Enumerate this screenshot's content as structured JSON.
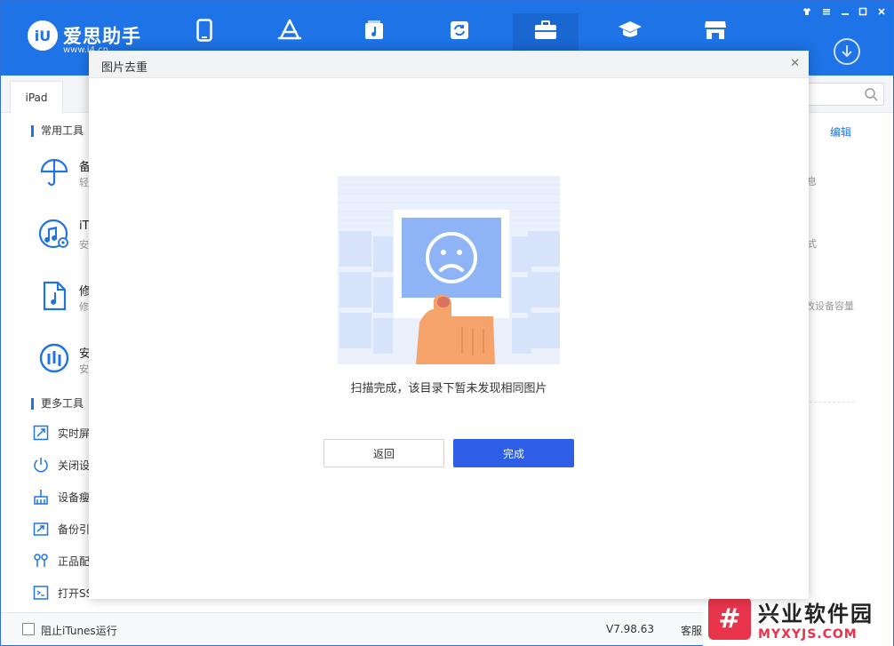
{
  "app": {
    "logo_badge": "iU",
    "logo_name": "爱思助手",
    "logo_url": "www.i4.cn",
    "nav_icons": [
      "phone-icon",
      "app-store-icon",
      "music-icon",
      "sync-icon",
      "toolbox-icon",
      "graduation-cap-icon",
      "store-icon"
    ],
    "window_controls": [
      "shirt-icon",
      "menu-icon",
      "minimize-icon",
      "maximize-icon",
      "close-icon"
    ]
  },
  "device_tab": "iPad",
  "sidebar": {
    "common_tools_title": "常用工具",
    "common_tools": [
      {
        "icon": "umbrella-icon",
        "t1": "备",
        "t2": "轻"
      },
      {
        "icon": "itunes-icon",
        "t1": "iT",
        "t2": "安"
      },
      {
        "icon": "music-file-icon",
        "t1": "修",
        "t2": "修"
      },
      {
        "icon": "i4-shield-icon",
        "t1": "安",
        "t2": "安"
      }
    ],
    "more_tools_title": "更多工具",
    "more_tools": [
      {
        "icon": "screen-icon",
        "label": "实时屏"
      },
      {
        "icon": "power-icon",
        "label": "关闭设"
      },
      {
        "icon": "broom-icon",
        "label": "设备瘦"
      },
      {
        "icon": "backup-icon",
        "label": "备份引"
      },
      {
        "icon": "earphone-icon",
        "label": "正品配"
      },
      {
        "icon": "terminal-icon",
        "label": "打开SS"
      }
    ]
  },
  "right_panel": {
    "edit_label": "编辑",
    "hints": [
      "息",
      "式",
      "改设备容量"
    ]
  },
  "bottom": {
    "itunes_label": "阻止iTunes运行",
    "version": "V7.98.63",
    "service": "客服"
  },
  "watermark": {
    "icon_text": "#",
    "cn": "兴业软件园",
    "en": "MYXYJS.COM"
  },
  "dialog": {
    "title": "图片去重",
    "message": "扫描完成，该目录下暂未发现相同图片",
    "back_label": "返回",
    "done_label": "完成"
  },
  "colors": {
    "brand_blue": "#1e73e6",
    "primary_button": "#2e5ee6",
    "illustration_blue": "#8fb4f5",
    "hand": "#f5a26b"
  }
}
